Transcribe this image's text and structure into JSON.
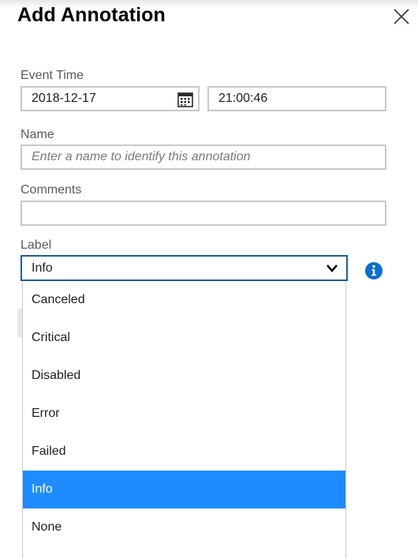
{
  "panel": {
    "title": "Add Annotation"
  },
  "event_time": {
    "label": "Event Time",
    "date_value": "2018-12-17",
    "time_value": "21:00:46"
  },
  "name": {
    "label": "Name",
    "placeholder": "Enter a name to identify this annotation"
  },
  "comments": {
    "label": "Comments",
    "value": ""
  },
  "label_field": {
    "label": "Label",
    "selected": "Info",
    "options": [
      "Canceled",
      "Critical",
      "Disabled",
      "Error",
      "Failed",
      "Info",
      "None"
    ]
  },
  "colors": {
    "selected_option_bg": "#1e8cff",
    "select_border": "#1b5f9e",
    "info_icon": "#0a6ed1"
  },
  "icons": [
    "close-icon",
    "calendar-icon",
    "chevron-down-icon",
    "info-icon"
  ]
}
